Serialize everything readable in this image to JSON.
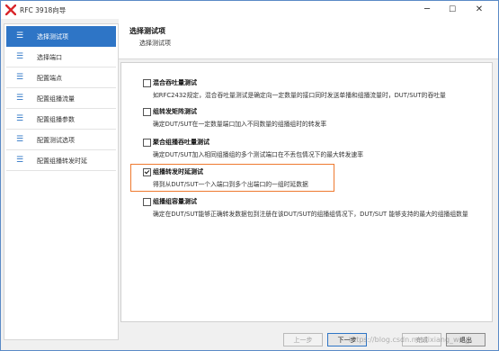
{
  "window": {
    "title": "RFC 3918向导",
    "app_icon": "red-x-logo-icon",
    "controls": {
      "minimize": "─",
      "maximize": "☐",
      "close": "✕"
    }
  },
  "header": {
    "title": "选择测试项",
    "subtitle": "选择测试项"
  },
  "sidebar": {
    "items": [
      {
        "label": "选择测试项",
        "active": true
      },
      {
        "label": "选择端口",
        "active": false
      },
      {
        "label": "配置端点",
        "active": false
      },
      {
        "label": "配置组播流量",
        "active": false
      },
      {
        "label": "配置组播参数",
        "active": false
      },
      {
        "label": "配置测试选项",
        "active": false
      },
      {
        "label": "配置组播转发时延",
        "active": false
      }
    ],
    "icon_glyph": "☰"
  },
  "options": [
    {
      "title": "混合吞吐量测试",
      "desc": "如RFC2432规定，混合吞吐量测试是确定向一定数量的接口同时发送单播和组播流量时，DUT/SUT的吞吐量",
      "checked": false
    },
    {
      "title": "组转发矩阵测试",
      "desc": "确定DUT/SUT在一定数量端口加入不同数量的组播组时的转发率",
      "checked": false
    },
    {
      "title": "聚合组播吞吐量测试",
      "desc": "确定DUT/SUT加入相同组播组的多个测试端口在不丢包情况下的最大转发速率",
      "checked": false
    },
    {
      "title": "组播转发时延测试",
      "desc": "得到从DUT/SUT一个入端口到多个出端口的一组时延数据",
      "checked": true
    },
    {
      "title": "组播组容量测试",
      "desc": "确定在DUT/SUT能够正确转发数据包到注册在该DUT/SUT的组播组情况下，DUT/SUT 能够支持的最大的组播组数量",
      "checked": false
    }
  ],
  "footer": {
    "prev": "上一步",
    "next": "下一步",
    "finish": "完成",
    "exit": "退出"
  },
  "watermark": "https://blog.csdn.net/lixiang_wei_"
}
